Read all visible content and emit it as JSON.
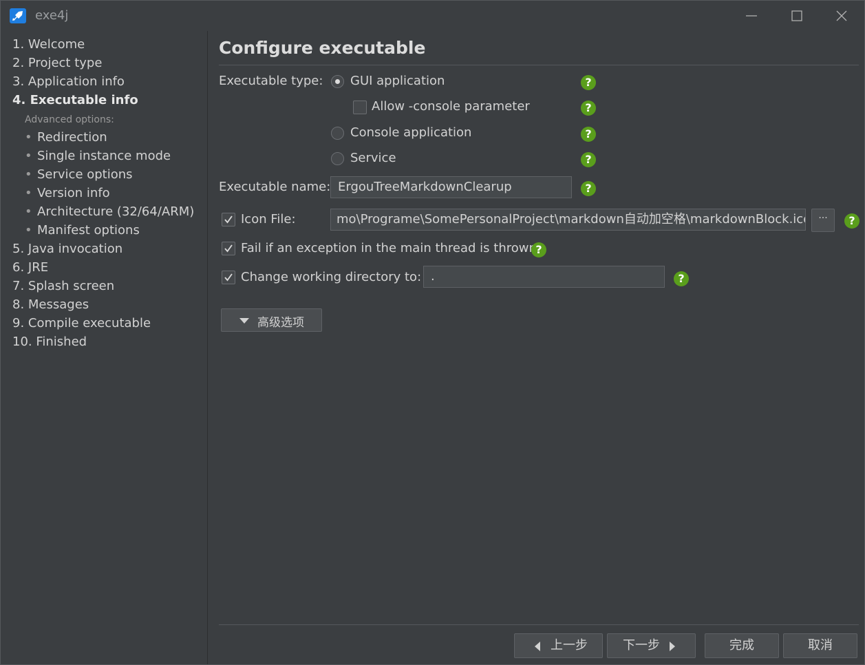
{
  "window": {
    "title": "exe4j",
    "icons": {
      "app": "rocket-icon",
      "minimize": "minimize-icon",
      "maximize": "maximize-icon",
      "close": "close-icon"
    }
  },
  "sidebar": {
    "items": [
      {
        "label": "1. Welcome"
      },
      {
        "label": "2. Project type"
      },
      {
        "label": "3. Application info"
      },
      {
        "label": "4. Executable info",
        "active": true
      }
    ],
    "advanced_heading": "Advanced options:",
    "sub_items": [
      {
        "label": "Redirection"
      },
      {
        "label": "Single instance mode"
      },
      {
        "label": "Service options"
      },
      {
        "label": "Version info"
      },
      {
        "label": "Architecture (32/64/ARM)"
      },
      {
        "label": "Manifest options"
      }
    ],
    "items_after": [
      {
        "label": "5. Java invocation"
      },
      {
        "label": "6. JRE"
      },
      {
        "label": "7. Splash screen"
      },
      {
        "label": "8. Messages"
      },
      {
        "label": "9. Compile executable"
      },
      {
        "label": "10. Finished"
      }
    ]
  },
  "main": {
    "title": "Configure executable",
    "executable_type": {
      "label": "Executable type:",
      "options": {
        "gui": {
          "label": "GUI application",
          "selected": true
        },
        "allow_console": {
          "label": "Allow -console parameter",
          "checked": false
        },
        "console": {
          "label": "Console application",
          "selected": false
        },
        "service": {
          "label": "Service",
          "selected": false
        }
      }
    },
    "executable_name": {
      "label": "Executable name:",
      "value": "ErgouTreeMarkdownClearup"
    },
    "icon_file": {
      "label": "Icon File:",
      "checked": true,
      "value": "mo\\Programe\\SomePersonalProject\\markdown自动加空格\\markdownBlock.ico",
      "browse_label": "···"
    },
    "fail_on_exception": {
      "label": "Fail if an exception in the main thread is thrown",
      "checked": true
    },
    "change_working_dir": {
      "label": "Change working directory to:",
      "checked": true,
      "value": "."
    },
    "advanced_button": "高级选项",
    "help_icon": "help-icon",
    "help_color": "#5a9e1c"
  },
  "footer": {
    "back": "上一步",
    "next": "下一步",
    "finish": "完成",
    "cancel": "取消"
  }
}
